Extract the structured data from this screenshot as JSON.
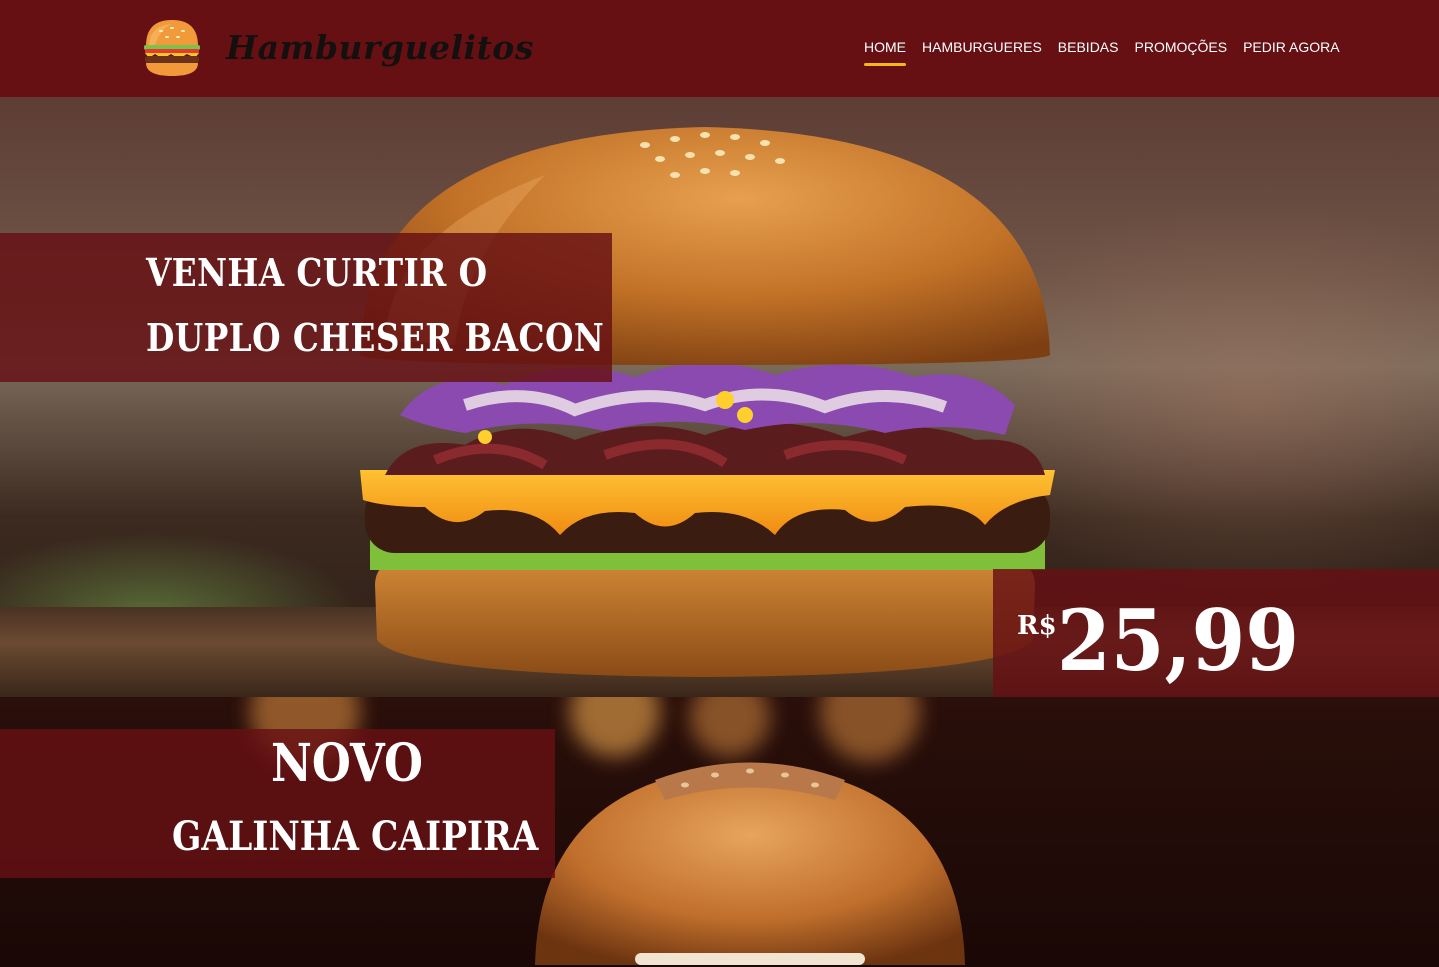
{
  "brand": {
    "name": "Hamburguelitos",
    "logo_icon": "hamburger-icon"
  },
  "nav": {
    "items": [
      {
        "label": "HOME",
        "active": true
      },
      {
        "label": "HAMBURGUERES",
        "active": false
      },
      {
        "label": "BEBIDAS",
        "active": false
      },
      {
        "label": "PROMOÇÕES",
        "active": false
      },
      {
        "label": "PEDIR AGORA",
        "active": false
      }
    ],
    "active_indicator_color": "#f7b718"
  },
  "hero": {
    "promo_line1": "VENHA CURTIR O",
    "promo_line2": "DUPLO CHESER BACON",
    "price_currency": "R$",
    "price_value": "25,99"
  },
  "second_banner": {
    "label": "NOVO",
    "product": "GALINHA CAIPIRA"
  },
  "colors": {
    "primary": "#661013",
    "accent": "#f7b718",
    "text_light": "#ffffff",
    "brand_text": "#141010"
  }
}
